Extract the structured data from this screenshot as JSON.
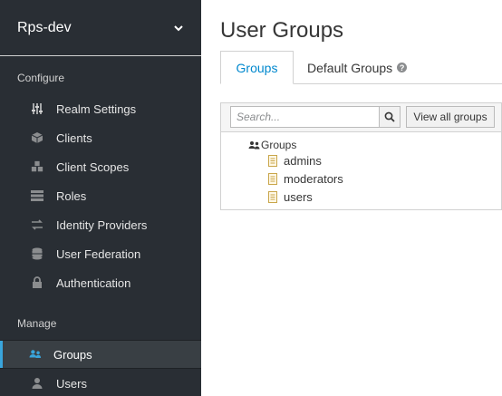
{
  "sidebar": {
    "realm": "Rps-dev",
    "section_configure": "Configure",
    "section_manage": "Manage",
    "configure_items": [
      {
        "label": "Realm Settings",
        "icon": "sliders-icon"
      },
      {
        "label": "Clients",
        "icon": "cube-icon"
      },
      {
        "label": "Client Scopes",
        "icon": "cubes-icon"
      },
      {
        "label": "Roles",
        "icon": "list-icon"
      },
      {
        "label": "Identity Providers",
        "icon": "exchange-icon"
      },
      {
        "label": "User Federation",
        "icon": "database-icon"
      },
      {
        "label": "Authentication",
        "icon": "lock-icon"
      }
    ],
    "manage_items": [
      {
        "label": "Groups",
        "icon": "users-icon",
        "active": true
      },
      {
        "label": "Users",
        "icon": "user-icon"
      }
    ]
  },
  "main": {
    "title": "User Groups",
    "tabs": [
      {
        "label": "Groups",
        "active": true
      },
      {
        "label": "Default Groups"
      }
    ],
    "search_placeholder": "Search...",
    "view_all_label": "View all groups",
    "tree_root": "Groups",
    "groups": [
      "admins",
      "moderators",
      "users"
    ]
  },
  "colors": {
    "sidebar_bg": "#292e34",
    "active_accent": "#39a5dc",
    "link_blue": "#0088ce"
  }
}
